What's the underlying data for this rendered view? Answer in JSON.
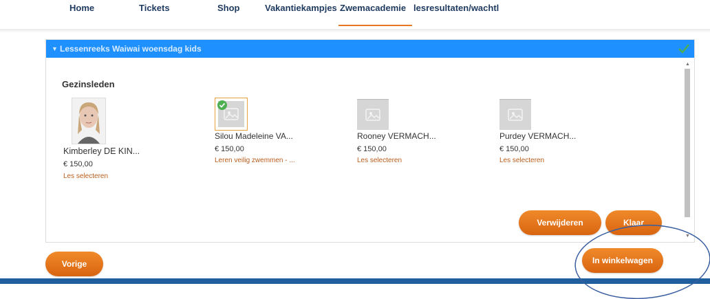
{
  "nav": {
    "tabs": [
      "Home",
      "Tickets",
      "Shop",
      "Vakantiekampjes",
      "Zwemacademie",
      "lesresultaten/wachtl"
    ],
    "active_index": 4
  },
  "panel": {
    "header_title": "Lessenreeks Waiwai woensdag kids",
    "section_title": "Gezinsleden",
    "members": [
      {
        "name": "Kimberley DE KIN...",
        "price": "€ 150,00",
        "link": "Les selecteren",
        "photo": "person-photo",
        "selected": false
      },
      {
        "name": "Silou Madeleine VA...",
        "price": "€ 150,00",
        "link": "Leren veilig zwemmen - ...",
        "photo": "placeholder-image-icon",
        "selected": true
      },
      {
        "name": "Rooney VERMACH...",
        "price": "€ 150,00",
        "link": "Les selecteren",
        "photo": "placeholder-image-icon",
        "selected": false
      },
      {
        "name": "Purdey VERMACH...",
        "price": "€ 150,00",
        "link": "Les selecteren",
        "photo": "placeholder-image-icon",
        "selected": false
      }
    ],
    "remove_label": "Verwijderen",
    "done_label": "Klaar"
  },
  "footer": {
    "previous_label": "Vorige",
    "cart_label": "In winkelwagen"
  },
  "colors": {
    "header_blue": "#1e90ff",
    "accent_orange": "#e87722",
    "link_orange": "#b85c1a",
    "check_green": "#4caf50",
    "bottom_bar": "#1f5f9e",
    "annotation_circle": "#3a5fa0"
  },
  "icons": [
    "chevron-down-icon",
    "checkmark-icon",
    "placeholder-image-icon",
    "selected-check-icon",
    "scroll-up-arrow-icon",
    "scroll-down-arrow-icon"
  ]
}
